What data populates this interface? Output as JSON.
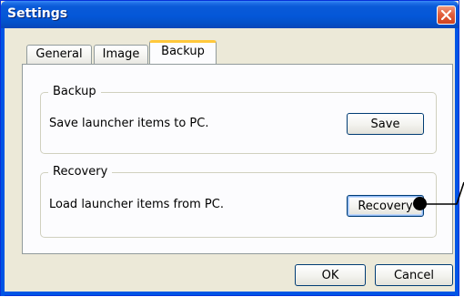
{
  "window": {
    "title": "Settings"
  },
  "tabs": [
    {
      "label": "General",
      "active": false
    },
    {
      "label": "Image",
      "active": false
    },
    {
      "label": "Backup",
      "active": true
    }
  ],
  "backup_group": {
    "title": "Backup",
    "description": "Save launcher items to PC.",
    "button_label": "Save"
  },
  "recovery_group": {
    "title": "Recovery",
    "description": "Load launcher items from PC.",
    "button_label": "Recovery"
  },
  "footer": {
    "ok_label": "OK",
    "cancel_label": "Cancel"
  },
  "colors": {
    "title_bar": "#0457d8",
    "close_button": "#d2431e",
    "active_tab_accent": "#ffc83c",
    "dialog_background": "#ece9d8"
  },
  "icons": {
    "close": "close-icon"
  }
}
